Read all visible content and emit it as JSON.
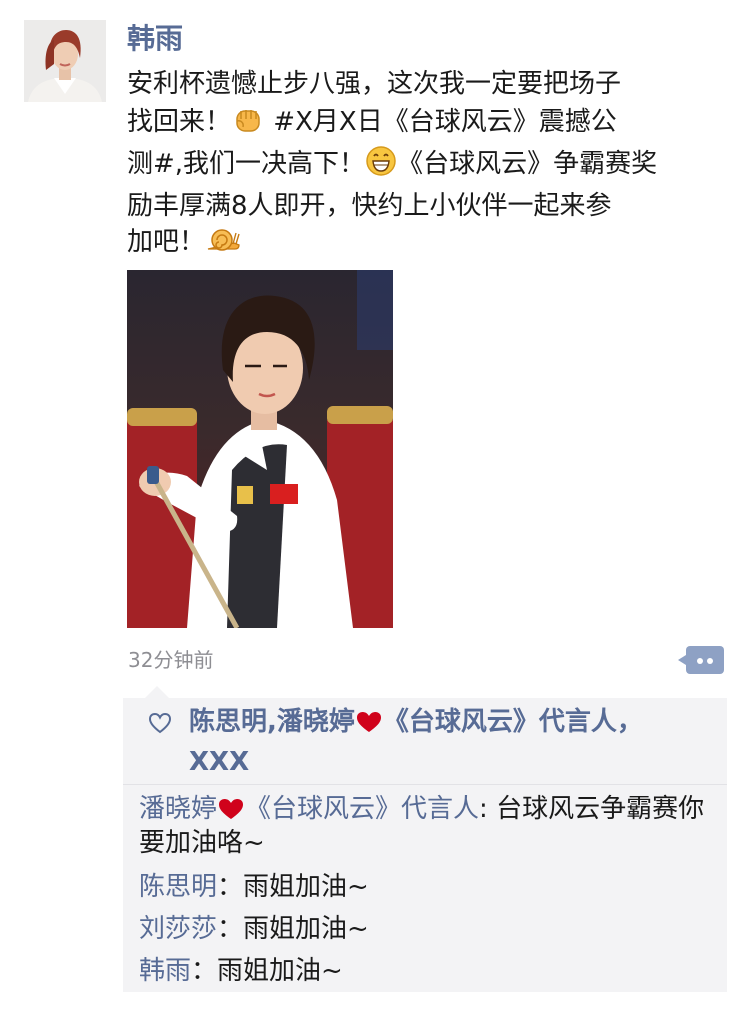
{
  "post": {
    "author": "韩雨",
    "avatar_icon": "user-avatar-photo",
    "text_lines": [
      [
        "安利杯遗憾止步八强，这次我一定要把场子",
        "找回来！",
        " #X月X日《台球风云》震撼公",
        "测#,我们一决高下！",
        "《台球风云》争霸赛奖",
        "励丰厚满8人即开，快约上小伙伴一起来参",
        "加吧！"
      ]
    ],
    "emojis": [
      "fist-emoji",
      "grin-emoji",
      "snail-emoji"
    ],
    "photo_icon": "billiards-player-photo",
    "timestamp": "32分钟前",
    "comment_button_icon": "comment-bubble-icon"
  },
  "likes": {
    "icon": "heart-outline-icon",
    "part1": "陈思明,潘晓婷",
    "part2": "《台球风云》代言人",
    "sep": "，",
    "part3": "XXX"
  },
  "comments": [
    {
      "name_a": "潘晓婷",
      "name_b": "《台球风云》代言人",
      "sep": ": ",
      "text": "台球风云争霸赛你要加油咯~"
    },
    {
      "name": "陈思明",
      "sep": "：",
      "text": "雨姐加油~"
    },
    {
      "name": "刘莎莎",
      "sep": "：",
      "text": "雨姐加油~"
    },
    {
      "name": "韩雨",
      "sep": "：",
      "text": "雨姐加油~"
    }
  ],
  "colors": {
    "link": "#576b95",
    "panel": "#f3f3f5",
    "heart": "#d0021b"
  }
}
